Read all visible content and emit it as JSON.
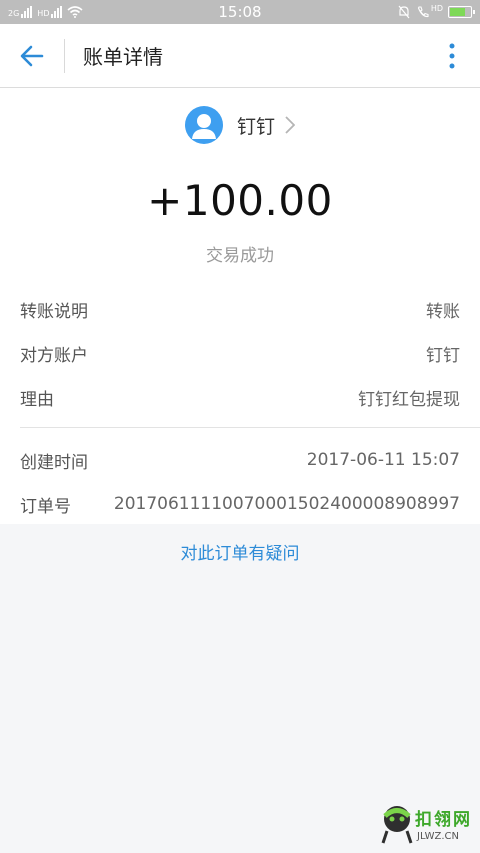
{
  "status_bar": {
    "time": "15:08",
    "sim1_tag": "2G",
    "sim2_tag": "HD",
    "hd_label": "HD"
  },
  "header": {
    "title": "账单详情",
    "back_icon": "arrow-left-icon",
    "more_icon": "more-vertical-icon"
  },
  "payee": {
    "name": "钉钉",
    "avatar_icon": "user-avatar-icon",
    "avatar_color": "#3e9ff0"
  },
  "amount": "+100.00",
  "transaction_status": "交易成功",
  "details": [
    {
      "label": "转账说明",
      "value": "转账"
    },
    {
      "label": "对方账户",
      "value": "钉钉"
    },
    {
      "label": "理由",
      "value": "钉钉红包提现"
    }
  ],
  "meta": [
    {
      "label": "创建时间",
      "value": "2017-06-11 15:07"
    },
    {
      "label": "订单号",
      "value": "20170611110070001502400008908997"
    }
  ],
  "question_link": "对此订单有疑问",
  "accent_color": "#2d8bd7",
  "watermark": {
    "text": "扣翎网",
    "sub": "JLWZ.CN"
  }
}
